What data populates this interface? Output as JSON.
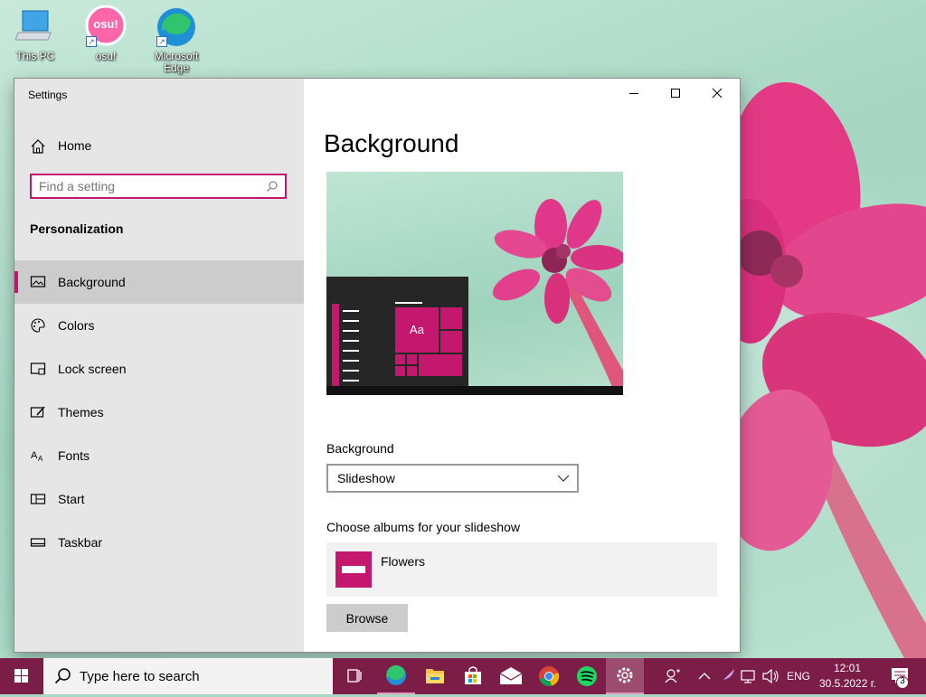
{
  "desktop": {
    "icons": [
      {
        "label": "This PC"
      },
      {
        "label": "osu!",
        "badge": "osu!"
      },
      {
        "label": "Microsoft Edge"
      }
    ]
  },
  "window": {
    "title": "Settings",
    "controls": {
      "minimize": "minimize",
      "maximize": "maximize",
      "close": "close"
    }
  },
  "sidebar": {
    "home_label": "Home",
    "search_placeholder": "Find a setting",
    "section_title": "Personalization",
    "items": [
      {
        "label": "Background",
        "icon": "image-icon",
        "active": true
      },
      {
        "label": "Colors",
        "icon": "palette-icon"
      },
      {
        "label": "Lock screen",
        "icon": "lock-screen-icon"
      },
      {
        "label": "Themes",
        "icon": "themes-icon"
      },
      {
        "label": "Fonts",
        "icon": "fonts-icon"
      },
      {
        "label": "Start",
        "icon": "start-icon"
      },
      {
        "label": "Taskbar",
        "icon": "taskbar-icon"
      }
    ]
  },
  "main": {
    "page_title": "Background",
    "preview": {
      "sample_text": "Aa"
    },
    "background_label": "Background",
    "background_value": "Slideshow",
    "albums_label": "Choose albums for your slideshow",
    "album_name": "Flowers",
    "browse_label": "Browse"
  },
  "taskbar": {
    "search_text": "Type here to search",
    "apps": [
      "task-view-icon",
      "edge-icon",
      "file-explorer-icon",
      "store-icon",
      "mail-icon",
      "chrome-icon",
      "spotify-icon",
      "settings-icon"
    ],
    "language": "ENG",
    "time": "12:01",
    "date": "30.5.2022 г.",
    "notification_count": "3"
  },
  "colors": {
    "accent": "#c3186d",
    "taskbar": "#7b1d46",
    "sidebar": "#e6e6e6"
  }
}
